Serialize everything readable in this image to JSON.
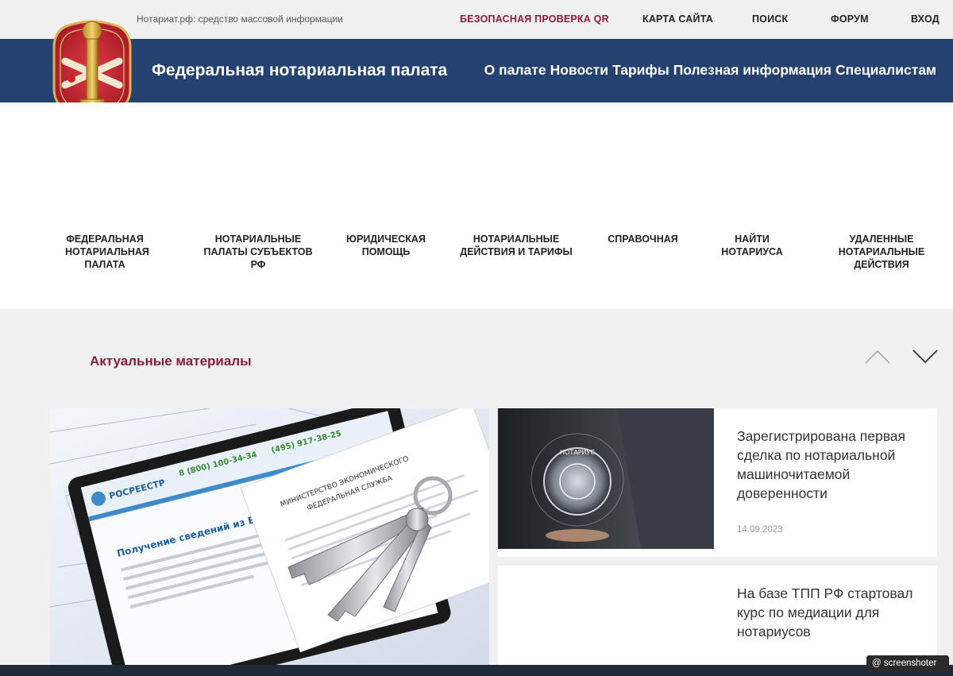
{
  "topbar": {
    "media_text": "Нотариат.рф: средство массовой информации",
    "links": [
      "БЕЗОПАСНАЯ ПРОВЕРКА QR",
      "КАРТА САЙТА",
      "ПОИСК",
      "ФОРУМ",
      "ВХОД"
    ]
  },
  "header": {
    "title": "Федеральная нотариальная палата",
    "nav": [
      "О палате",
      "Новости",
      "Тарифы",
      "Полезная информация",
      "Специалистам"
    ]
  },
  "categories": [
    "ФЕДЕРАЛЬНАЯ\nНОТАРИАЛЬНАЯ\nПАЛАТА",
    "НОТАРИАЛЬНЫЕ\nПАЛАТЫ СУБЪЕКТОВ\nРФ",
    "ЮРИДИЧЕСКАЯ\nПОМОЩЬ",
    "НОТАРИАЛЬНЫЕ\nДЕЙСТВИЯ И ТАРИФЫ",
    "СПРАВОЧНАЯ",
    "НАЙТИ\nНОТАРИУСА",
    "УДАЛЕННЫЕ\nНОТАРИАЛЬНЫЕ\nДЕЙСТВИЯ"
  ],
  "materials": {
    "title": "Актуальные материалы",
    "big_image_text": {
      "rosreestr": "РОСРЕЕСТР",
      "phone": "8 (800) 100-34-34",
      "phone2": "(495) 917-38-25",
      "form_title": "Получение сведений из ЕГРН",
      "ministry": "МИНИСТЕРСТВО ЭКОНОМИЧЕСКОГО",
      "ministry2": "ФЕДЕРАЛЬНАЯ СЛУЖБА"
    },
    "news": [
      {
        "title": "Зарегистрирована первая сделка по нотариальной машиночитаемой доверенности",
        "date": "14.09.2023"
      },
      {
        "title": "На базе ТПП РФ стартовал курс по медиации для нотариусов"
      }
    ],
    "coin_text": "НОТАРИУС"
  },
  "screenshoter": "@ screenshoter",
  "colors": {
    "header_blue": "#25416f",
    "accent": "#8b1c3a"
  }
}
